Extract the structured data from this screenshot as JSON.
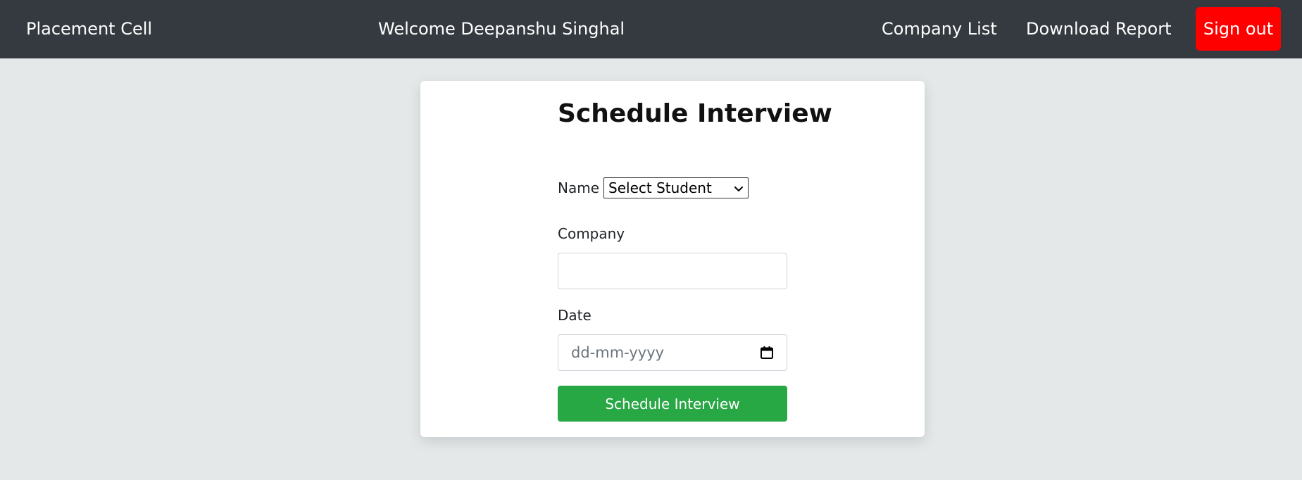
{
  "navbar": {
    "brand": "Placement Cell",
    "welcome": "Welcome Deepanshu Singhal",
    "links": {
      "company_list": "Company List",
      "download_report": "Download Report"
    },
    "signout_label": "Sign out"
  },
  "form": {
    "title": "Schedule Interview",
    "name_label": "Name",
    "student_select": {
      "selected": "Select Student"
    },
    "company_label": "Company",
    "company_value": "",
    "date_label": "Date",
    "date_placeholder": "dd-mm-yyyy",
    "submit_label": "Schedule Interview"
  },
  "icons": {
    "select": "chevron-down-icon",
    "date": "calendar-icon"
  },
  "colors": {
    "navbar_bg": "#343a40",
    "page_bg": "#e4e8e9",
    "signout_bg": "#ff0000",
    "submit_bg": "#28a745"
  }
}
